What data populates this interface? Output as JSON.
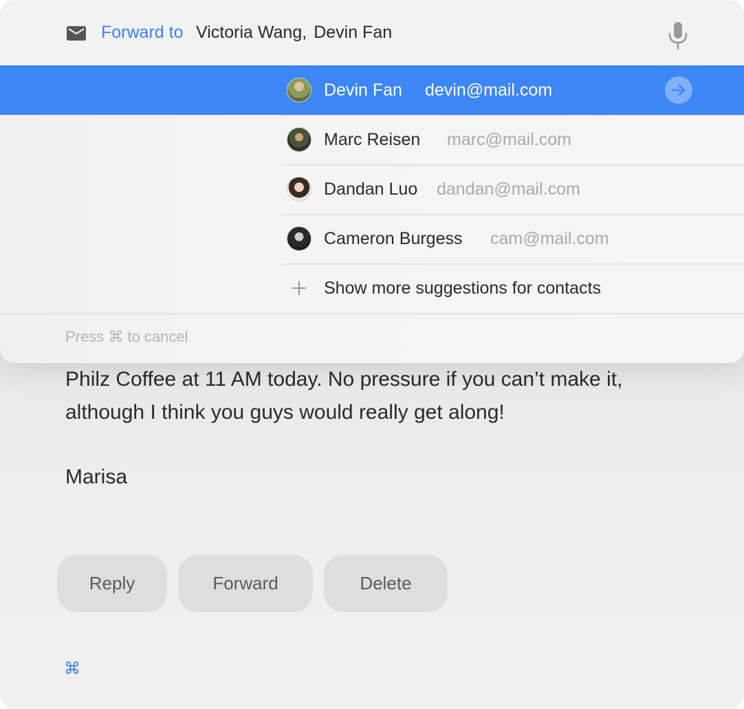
{
  "header": {
    "forward_label": "Forward to",
    "recipients": [
      "Victoria Wang,",
      "Devin Fan"
    ]
  },
  "suggestions": [
    {
      "name": "Devin Fan",
      "email": "devin@mail.com",
      "selected": true
    },
    {
      "name": "Marc Reisen",
      "email": "marc@mail.com",
      "selected": false
    },
    {
      "name": "Dandan Luo",
      "email": "dandan@mail.com",
      "selected": false
    },
    {
      "name": "Cameron Burgess",
      "email": "cam@mail.com",
      "selected": false
    }
  ],
  "more_suggestions_label": "Show more suggestions for contacts",
  "cancel_hint": "Press ⌘ to cancel",
  "email_body": {
    "lines": [
      "Philz Coffee at 11 AM today. No pressure if you can’t make it,",
      "although I think you guys would really get along!"
    ],
    "signature": "Marisa"
  },
  "actions": {
    "reply": "Reply",
    "forward": "Forward",
    "delete": "Delete"
  },
  "command_glyph": "⌘",
  "colors": {
    "accent": "#3d86f5",
    "link_blue": "#3b82f6"
  }
}
